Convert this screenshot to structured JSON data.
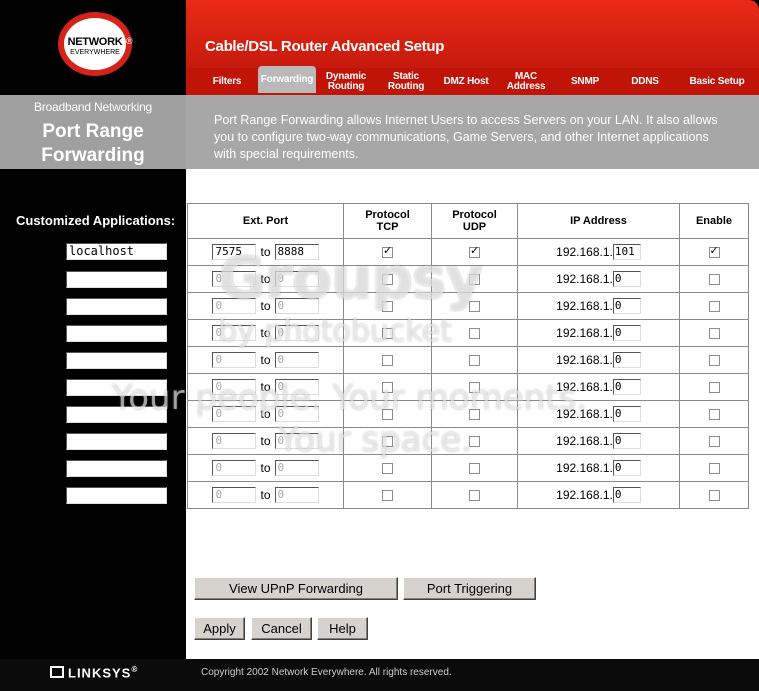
{
  "header": {
    "logo_text": "NETWORK",
    "logo_sub": "EVERYWHERE",
    "logo_reg": "®",
    "title": "Cable/DSL Router Advanced Setup"
  },
  "tabs": [
    {
      "label": "Filters",
      "active": false
    },
    {
      "label": "Forwarding",
      "active": true
    },
    {
      "label": "Dynamic Routing",
      "active": false
    },
    {
      "label": "Static Routing",
      "active": false
    },
    {
      "label": "DMZ Host",
      "active": false
    },
    {
      "label": "MAC Address",
      "active": false
    },
    {
      "label": "SNMP",
      "active": false
    },
    {
      "label": "DDNS",
      "active": false
    },
    {
      "label": "Basic Setup",
      "active": false
    }
  ],
  "section": {
    "category": "Broadband Networking",
    "title_line1": "Port Range",
    "title_line2": "Forwarding",
    "description": "Port Range Forwarding allows Internet Users to access Servers on your LAN. It also allows you to configure two-way communications, Game Servers, and other Internet applications with special requirements."
  },
  "apps_label": "Customized Applications:",
  "table": {
    "headers": {
      "ext_port": "Ext. Port",
      "tcp": "Protocol TCP",
      "udp": "Protocol UDP",
      "ip": "IP Address",
      "enable": "Enable"
    },
    "to_label": "to",
    "ip_prefix": "192.168.1.",
    "rows": [
      {
        "app": "localhost",
        "start": "7575",
        "end": "8888",
        "tcp": true,
        "udp": true,
        "ip": "101",
        "enable": true
      },
      {
        "app": "",
        "start": "0",
        "end": "0",
        "tcp": false,
        "udp": false,
        "ip": "0",
        "enable": false
      },
      {
        "app": "",
        "start": "0",
        "end": "0",
        "tcp": false,
        "udp": false,
        "ip": "0",
        "enable": false
      },
      {
        "app": "",
        "start": "0",
        "end": "0",
        "tcp": false,
        "udp": false,
        "ip": "0",
        "enable": false
      },
      {
        "app": "",
        "start": "0",
        "end": "0",
        "tcp": false,
        "udp": false,
        "ip": "0",
        "enable": false
      },
      {
        "app": "",
        "start": "0",
        "end": "0",
        "tcp": false,
        "udp": false,
        "ip": "0",
        "enable": false
      },
      {
        "app": "",
        "start": "0",
        "end": "0",
        "tcp": false,
        "udp": false,
        "ip": "0",
        "enable": false
      },
      {
        "app": "",
        "start": "0",
        "end": "0",
        "tcp": false,
        "udp": false,
        "ip": "0",
        "enable": false
      },
      {
        "app": "",
        "start": "0",
        "end": "0",
        "tcp": false,
        "udp": false,
        "ip": "0",
        "enable": false
      },
      {
        "app": "",
        "start": "0",
        "end": "0",
        "tcp": false,
        "udp": false,
        "ip": "0",
        "enable": false
      }
    ]
  },
  "buttons": {
    "upnp": "View UPnP Forwarding",
    "triggering": "Port Triggering",
    "apply": "Apply",
    "cancel": "Cancel",
    "help": "Help"
  },
  "watermark": {
    "brand": "Groupsy",
    "by": "by photobucket",
    "line1": "Your people. Your moments.",
    "line2": "Your space."
  },
  "footer": {
    "brand": "LINKSYS",
    "reg": "®",
    "copyright": "Copyright 2002 Network Everywhere. All rights reserved."
  },
  "colors": {
    "header_red": "#d82214",
    "band_gray": "#a7a7a7"
  }
}
